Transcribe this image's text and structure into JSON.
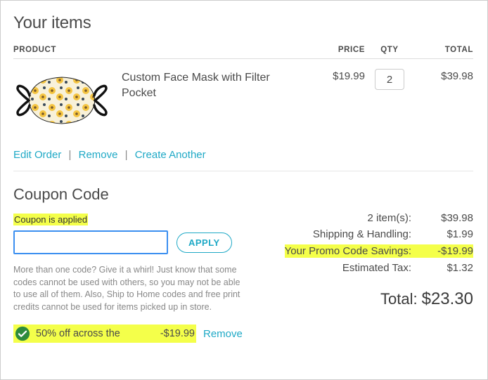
{
  "title": "Your items",
  "headers": {
    "product": "PRODUCT",
    "price": "PRICE",
    "qty": "QTY",
    "total": "TOTAL"
  },
  "item": {
    "name": "Custom Face Mask with Filter Pocket",
    "price": "$19.99",
    "qty": "2",
    "total": "$39.98"
  },
  "actions": {
    "edit": "Edit Order",
    "remove": "Remove",
    "create": "Create Another"
  },
  "coupon": {
    "title": "Coupon Code",
    "applied_msg": "Coupon is applied",
    "apply_btn": "APPLY",
    "help": "More than one code? Give it a whirl! Just know that some codes cannot be used with others, so you may not be able to use all of them. Also, Ship to Home codes and free print credits cannot be used for items picked up in store.",
    "applied_name": "50% off across the",
    "applied_amount": "-$19.99",
    "remove": "Remove"
  },
  "summary": {
    "items_label": "2 item(s):",
    "items_val": "$39.98",
    "ship_label": "Shipping & Handling:",
    "ship_val": "$1.99",
    "promo_label": "Your Promo Code Savings:",
    "promo_val": "-$19.99",
    "tax_label": "Estimated Tax:",
    "tax_val": "$1.32",
    "total_label": "Total:",
    "total_val": "$23.30"
  }
}
